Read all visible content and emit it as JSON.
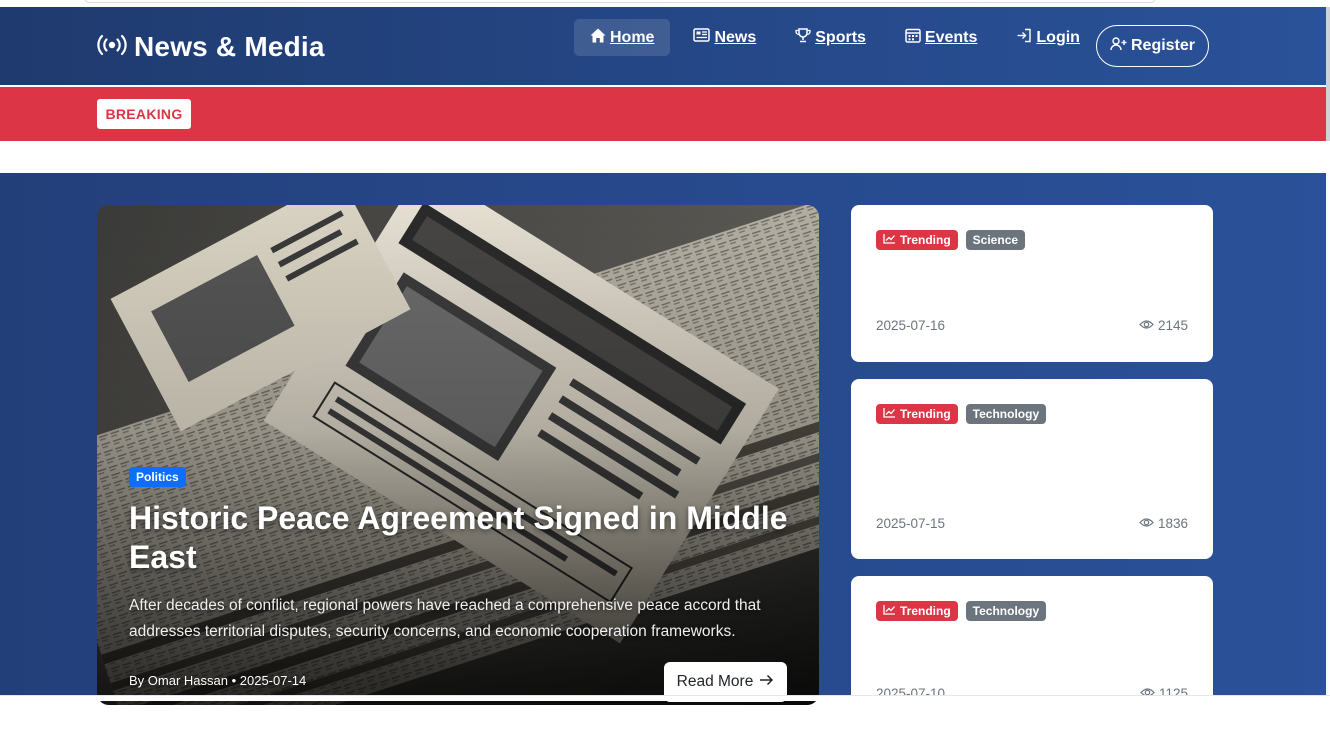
{
  "brand": {
    "name": "News & Media"
  },
  "nav": {
    "items": [
      {
        "label": "Home",
        "icon": "home-icon",
        "active": true
      },
      {
        "label": "News",
        "icon": "newspaper-icon",
        "active": false
      },
      {
        "label": "Sports",
        "icon": "trophy-icon",
        "active": false
      },
      {
        "label": "Events",
        "icon": "calendar-icon",
        "active": false
      },
      {
        "label": "Login",
        "icon": "login-icon",
        "active": false
      }
    ],
    "register_label": "Register"
  },
  "breaking": {
    "label": "BREAKING"
  },
  "hero": {
    "category": "Politics",
    "title": "Historic Peace Agreement Signed in Middle East",
    "description": "After decades of conflict, regional powers have reached a comprehensive peace accord that addresses territorial disputes, security concerns, and economic cooperation frameworks.",
    "meta": "By Omar Hassan • 2025-07-14",
    "read_more_label": "Read More"
  },
  "side_cards": [
    {
      "trending_label": "Trending",
      "category": "Science",
      "date": "2025-07-16",
      "views": "2145"
    },
    {
      "trending_label": "Trending",
      "category": "Technology",
      "date": "2025-07-15",
      "views": "1836"
    },
    {
      "trending_label": "Trending",
      "category": "Technology",
      "date": "2025-07-10",
      "views": "1125"
    }
  ],
  "colors": {
    "navbar": "#26498a",
    "breaking": "#dc3545",
    "politics_badge": "#0d6efd",
    "category_badge": "#6c757d"
  }
}
